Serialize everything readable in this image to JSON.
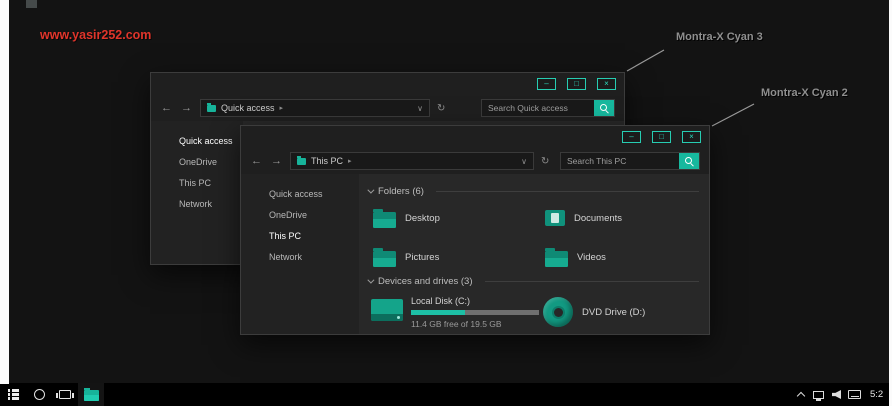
{
  "desktop": {
    "watermark": "www.yasir252.com",
    "annotation_back": "Montra-X Cyan 3",
    "annotation_front": "Montra-X Cyan 2"
  },
  "glyphs": {
    "minimize": "–",
    "maximize": "□",
    "close": "×",
    "back": "←",
    "forward": "→",
    "dropdown": "∨",
    "refresh": "↻",
    "crumb_chevron": "▸"
  },
  "window_back": {
    "breadcrumb": "Quick access",
    "search_placeholder": "Search Quick access",
    "sidebar": [
      "Quick access",
      "OneDrive",
      "This PC",
      "Network"
    ]
  },
  "window_front": {
    "breadcrumb": "This PC",
    "search_placeholder": "Search This PC",
    "sidebar": [
      "Quick access",
      "OneDrive",
      "This PC",
      "Network"
    ],
    "folders_section": {
      "title": "Folders (6)",
      "items": [
        {
          "label": "Desktop"
        },
        {
          "label": "Documents"
        },
        {
          "label": "Pictures"
        },
        {
          "label": "Videos"
        }
      ]
    },
    "devices_section": {
      "title": "Devices and drives (3)",
      "items": [
        {
          "label": "Local Disk (C:)",
          "detail": "11.4 GB free of 19.5 GB",
          "used_pct": 42
        },
        {
          "label": "DVD Drive (D:)"
        }
      ]
    }
  },
  "taskbar": {
    "clock": "5:2"
  },
  "colors": {
    "accent": "#1dbfa5",
    "accent_dark": "#0d7a68",
    "caption_outline": "#27cdb2",
    "watermark_red": "#e0352b"
  }
}
